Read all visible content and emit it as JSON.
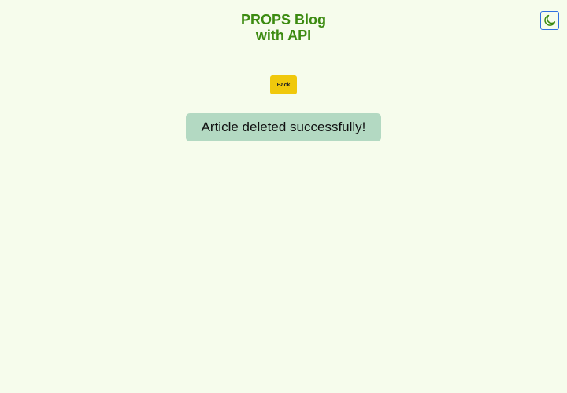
{
  "header": {
    "title_line1": "PROPS Blog",
    "title_line2": "with API"
  },
  "theme_toggle": {
    "icon": "moon-icon",
    "color": "#3c8b11",
    "border_color": "#2f6fe0"
  },
  "actions": {
    "back_label": "Back"
  },
  "notification": {
    "message": "Article deleted successfully!"
  },
  "colors": {
    "background": "#f6fcec",
    "title": "#3c8b11",
    "back_button": "#f0c80c",
    "toast": "#b3d9c2"
  }
}
